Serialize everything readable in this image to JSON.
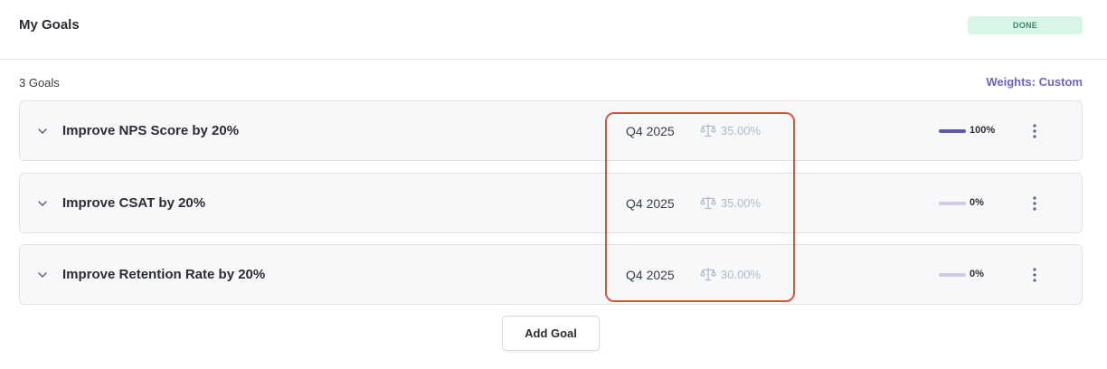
{
  "header": {
    "title": "My Goals",
    "status": "DONE"
  },
  "goals_summary": {
    "count_label": "3 Goals",
    "weights_label": "Weights: Custom"
  },
  "goals": [
    {
      "title": "Improve NPS Score by 20%",
      "quarter": "Q4 2025",
      "weight": "35.00%",
      "progress": 1.0,
      "progress_label": "100%"
    },
    {
      "title": "Improve CSAT by 20%",
      "quarter": "Q4 2025",
      "weight": "35.00%",
      "progress": 0.0,
      "progress_label": "0%"
    },
    {
      "title": "Improve Retention Rate by 20%",
      "quarter": "Q4 2025",
      "weight": "30.00%",
      "progress": 0.0,
      "progress_label": "0%"
    }
  ],
  "actions": {
    "add_goal_label": "Add Goal"
  },
  "icons": {
    "expand": "chevron-down-icon",
    "weight": "scale-icon",
    "more": "more-vertical-icon"
  },
  "colors": {
    "accent": "#6b65c8",
    "progress_fill": "#5e58b5",
    "progress_track": "#cfcbe8",
    "done_badge_bg": "#d8f5e8",
    "done_badge_text": "#3c8a62",
    "highlight": "#d9553e"
  }
}
